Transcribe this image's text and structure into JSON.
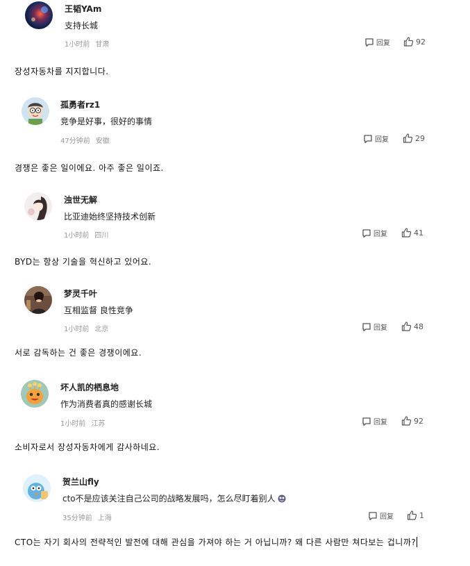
{
  "comments": [
    {
      "username": "王韬YAm",
      "text": "支持长城",
      "time": "1小时前",
      "location": "甘肃",
      "reply_label": "回复",
      "likes": "92",
      "translation": "장성자동차를 지지합니다.",
      "avatar_icon": "galaxy-avatar-icon"
    },
    {
      "username": "孤勇者rz1",
      "text": "竞争是好事，很好的事情",
      "time": "47分钟前",
      "location": "安徽",
      "reply_label": "回复",
      "likes": "29",
      "translation": "경쟁은 좋은 일이에요. 아주 좋은 일이죠.",
      "avatar_icon": "cartoon-kid-avatar-icon"
    },
    {
      "username": "浊世无解",
      "text": "比亚迪始终坚持技术创新",
      "time": "1小时前",
      "location": "四川",
      "reply_label": "回复",
      "likes": "41",
      "translation": "BYD는 항상 기술을 혁신하고 있어요.",
      "avatar_icon": "sketch-portrait-avatar-icon"
    },
    {
      "username": "梦灵千叶",
      "text": "互相监督 良性竞争",
      "time": "1小时前",
      "location": "北京",
      "reply_label": "回复",
      "likes": "48",
      "translation": "서로 감독하는 건 좋은 경쟁이에요.",
      "avatar_icon": "photo-portrait-avatar-icon"
    },
    {
      "username": "坏人凯的栖息地",
      "text": "作为消费者真的感谢长城",
      "time": "1小时前",
      "location": "江苏",
      "reply_label": "回复",
      "likes": "92",
      "translation": "소비자로서 장성자동차에게 감사하네요.",
      "avatar_icon": "monster-avatar-icon"
    },
    {
      "username": "贺兰山fly",
      "text": "cto不是应该关注自己公司的战略发展吗，怎么尽盯着别人",
      "time": "35分钟前",
      "location": "上海",
      "reply_label": "回复",
      "likes": "1",
      "translation": "CTO는 자기 회사의 전략적인 발전에 대해 관심을 가져야 하는 거 아닙니까? 왜 다른 사람만 쳐다보는 겁니까?",
      "avatar_icon": "blue-cartoon-avatar-icon"
    }
  ],
  "colors": {
    "text": "#222222",
    "meta": "#999999",
    "icon": "#555555"
  }
}
